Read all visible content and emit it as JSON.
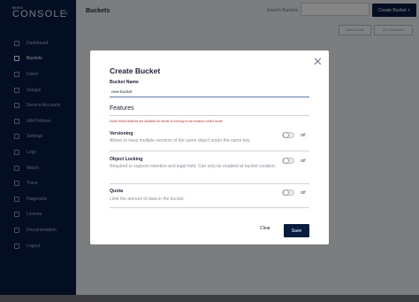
{
  "sidebar": {
    "logo_small": "MINIO",
    "logo_big": "CONSOLE",
    "collapse_icon": "chevron-left-icon",
    "items": [
      {
        "label": "Dashboard",
        "icon": "dashboard-icon",
        "active": false
      },
      {
        "label": "Buckets",
        "icon": "bucket-icon",
        "active": true
      },
      {
        "label": "Users",
        "icon": "users-icon",
        "active": false
      },
      {
        "label": "Groups",
        "icon": "groups-icon",
        "active": false
      },
      {
        "label": "Service Accounts",
        "icon": "key-icon",
        "active": false
      },
      {
        "label": "IAM Policies",
        "icon": "policy-icon",
        "active": false
      },
      {
        "label": "Settings",
        "icon": "gear-icon",
        "active": false
      },
      {
        "label": "Logs",
        "icon": "logs-icon",
        "active": false
      },
      {
        "label": "Watch",
        "icon": "eye-icon",
        "active": false
      },
      {
        "label": "Trace",
        "icon": "trace-icon",
        "active": false
      },
      {
        "label": "Diagnostic",
        "icon": "diagnostic-icon",
        "active": false
      },
      {
        "label": "License",
        "icon": "license-icon",
        "active": false
      },
      {
        "label": "Documentation",
        "icon": "documentation-icon",
        "active": false
      },
      {
        "label": "Logout",
        "icon": "logout-icon",
        "active": false
      }
    ]
  },
  "header": {
    "title": "Buckets",
    "search_label": "Search Buckets",
    "search_value": "",
    "create_button": "Create Bucket +",
    "tool_buttons": [
      "Batch Delete",
      "Set Replication"
    ]
  },
  "modal": {
    "title": "Create Bucket",
    "close_icon": "close-icon",
    "bucket_name_label": "Bucket Name",
    "bucket_name_value": "new-bucket",
    "features_title": "Features",
    "warning": "Some these features are disabled as server is running in non-erasure coded mode",
    "options": [
      {
        "title": "Versioning",
        "description": "Allows to keep multiple versions of the same object under the same key.",
        "state": "Off"
      },
      {
        "title": "Object Locking",
        "description": "Required to support retention and legal hold. Can only be enabled at bucket creation.",
        "state": "Off"
      },
      {
        "title": "Quota",
        "description": "Limit the amount of data in the bucket.",
        "state": "Off"
      }
    ],
    "clear_label": "Clear",
    "save_label": "Save"
  },
  "colors": {
    "sidebar_bg": "#081c42",
    "primary_button": "#081c42",
    "warning_text": "#c1272d",
    "overlay": "rgba(0,0,0,0.48)"
  }
}
